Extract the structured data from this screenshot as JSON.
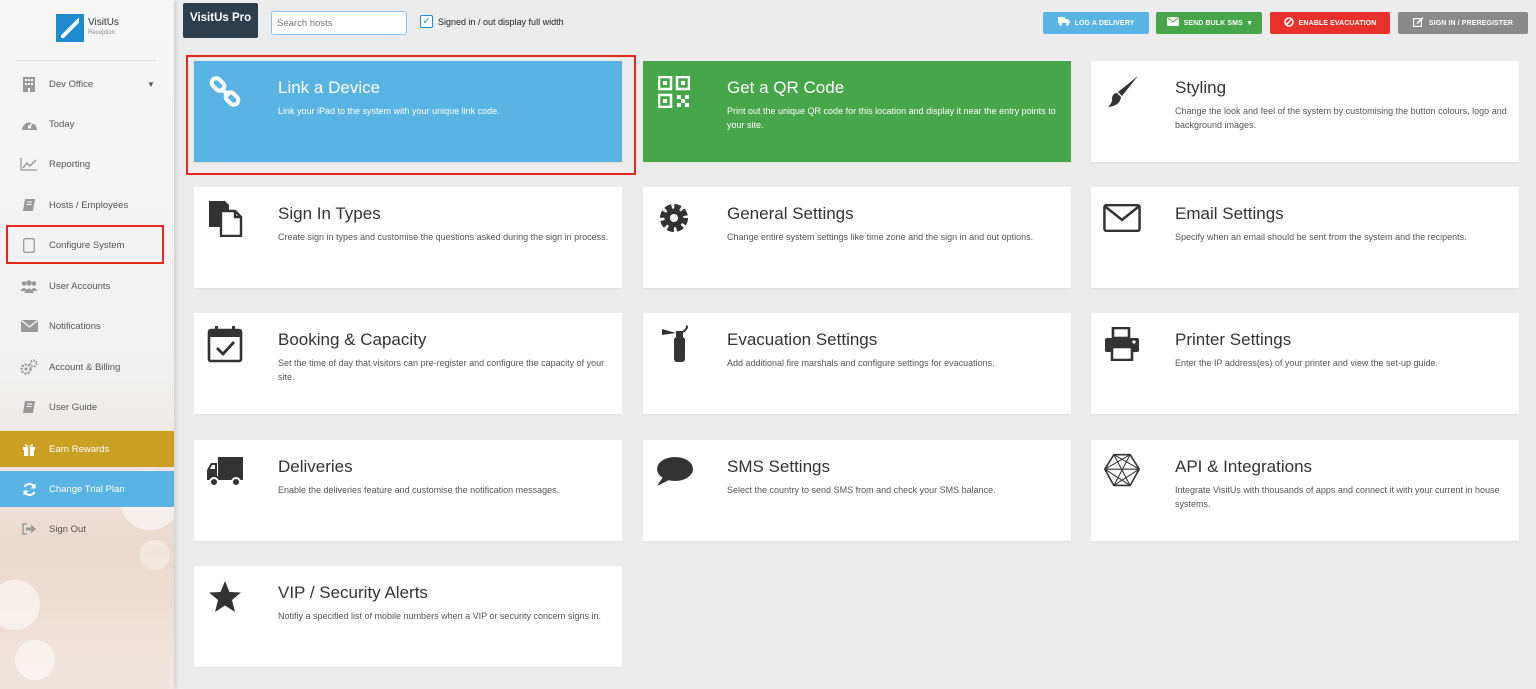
{
  "app": {
    "brand": "VisitUs Pro",
    "logo_name": "VisitUs",
    "logo_sub": "Reception"
  },
  "topbar": {
    "search_placeholder": "Search hosts",
    "full_width_checkbox_label": "Signed in / out display full width",
    "full_width_checked": true,
    "buttons": {
      "log_delivery": "LOG A DELIVERY",
      "send_bulk_sms": "SEND BULK SMS",
      "enable_evacuation": "ENABLE EVACUATION",
      "sign_in_preregister": "SIGN IN / PREREGISTER"
    }
  },
  "sidebar": {
    "items": [
      {
        "label": "Dev Office",
        "icon": "building-icon"
      },
      {
        "label": "Today",
        "icon": "dashboard-icon"
      },
      {
        "label": "Reporting",
        "icon": "chart-icon"
      },
      {
        "label": "Hosts / Employees",
        "icon": "book-icon"
      },
      {
        "label": "Configure System",
        "icon": "tablet-icon"
      },
      {
        "label": "User Accounts",
        "icon": "users-icon"
      },
      {
        "label": "Notifications",
        "icon": "envelope-icon"
      },
      {
        "label": "Account & Billing",
        "icon": "cogs-icon"
      },
      {
        "label": "User Guide",
        "icon": "book-icon"
      },
      {
        "label": "Earn Rewards",
        "icon": "gift-icon"
      },
      {
        "label": "Change Trial Plan",
        "icon": "refresh-icon"
      },
      {
        "label": "Sign Out",
        "icon": "sign-out-icon"
      }
    ]
  },
  "cards": [
    {
      "title": "Link a Device",
      "desc": "Link your iPad to the system with your unique link code.",
      "icon": "link-icon"
    },
    {
      "title": "Get a QR Code",
      "desc": "Print out the unique QR code for this location and display it near the entry points to your site.",
      "icon": "qrcode-icon"
    },
    {
      "title": "Styling",
      "desc": "Change the look and feel of the system by customising the button colours, logo and background images.",
      "icon": "paintbrush-icon"
    },
    {
      "title": "Sign In Types",
      "desc": "Create sign in types and customise the questions asked during the sign in process.",
      "icon": "documents-icon"
    },
    {
      "title": "General Settings",
      "desc": "Change entire system settings like time zone and the sign in and out options.",
      "icon": "gear-icon"
    },
    {
      "title": "Email Settings",
      "desc": "Specify when an email should be sent from the system and the recipents.",
      "icon": "envelope-icon"
    },
    {
      "title": "Booking & Capacity",
      "desc": "Set the time of day that visitors can pre-register and configure the capacity of your site.",
      "icon": "calendar-check-icon"
    },
    {
      "title": "Evacuation Settings",
      "desc": "Add additional fire marshals and configure settings for evacuations.",
      "icon": "fire-extinguisher-icon"
    },
    {
      "title": "Printer Settings",
      "desc": "Enter the IP address(es) of your printer and view the set-up guide.",
      "icon": "printer-icon"
    },
    {
      "title": "Deliveries",
      "desc": "Enable the deliveries feature and customise the notification messages.",
      "icon": "truck-icon"
    },
    {
      "title": "SMS Settings",
      "desc": "Select the country to send SMS from and check your SMS balance.",
      "icon": "speech-bubble-icon"
    },
    {
      "title": "API & Integrations",
      "desc": "Integrate VisitUs with thousands of apps and connect it with your current in house systems.",
      "icon": "network-icon"
    },
    {
      "title": "VIP / Security Alerts",
      "desc": "Notifiy a specified list of mobile numbers when a VIP or security concern signs in.",
      "icon": "star-icon"
    }
  ],
  "colors": {
    "accent_blue": "#5ab4e3",
    "accent_green": "#47a64a",
    "danger_red": "#e8312a",
    "reward_gold": "#c9a023",
    "highlight_red": "#e0281c"
  }
}
